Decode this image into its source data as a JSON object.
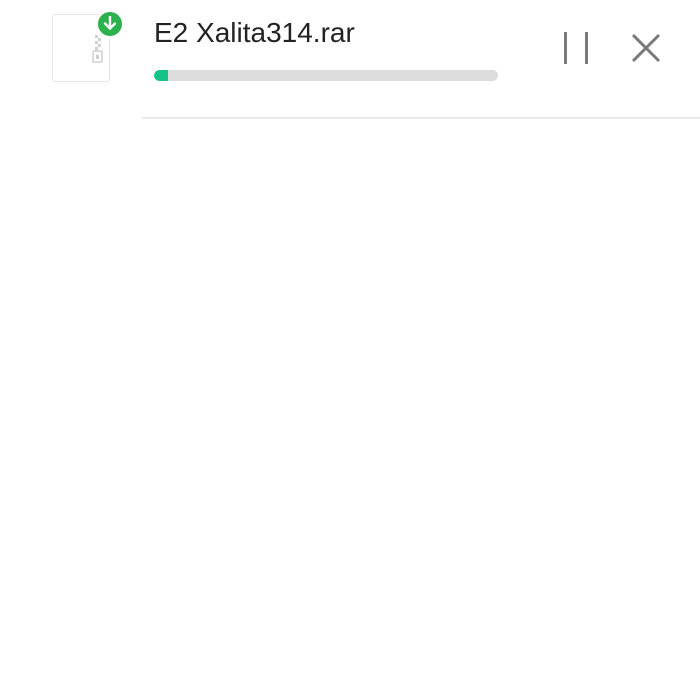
{
  "download": {
    "file_name": "E2 Xalita314.rar",
    "progress": 0.04,
    "file_icon": "archive-file-icon",
    "badge_icon": "download-arrow-icon",
    "actions": {
      "pause_icon": "pause-icon",
      "cancel_icon": "close-icon"
    }
  },
  "colors": {
    "badge": "#2bb24c",
    "progress_fill": "#15c28a",
    "progress_track": "#dcdcdc",
    "text": "#222222",
    "action_icons": "#7a7a7a"
  }
}
